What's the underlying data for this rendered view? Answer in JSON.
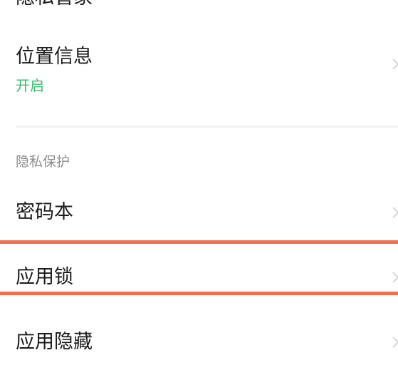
{
  "top_item": {
    "label": "隐私管家"
  },
  "location": {
    "label": "位置信息",
    "status": "开启"
  },
  "privacy_section": {
    "header": "隐私保护",
    "items": [
      {
        "label": "密码本"
      },
      {
        "label": "应用锁"
      },
      {
        "label": "应用隐藏"
      }
    ]
  },
  "colors": {
    "status_green": "#3dba6b",
    "highlight": "#ee7348",
    "text": "#1b1b1b",
    "secondary": "#8c8c8c"
  },
  "icons": {
    "row_arrow": "chevron-right-icon"
  }
}
